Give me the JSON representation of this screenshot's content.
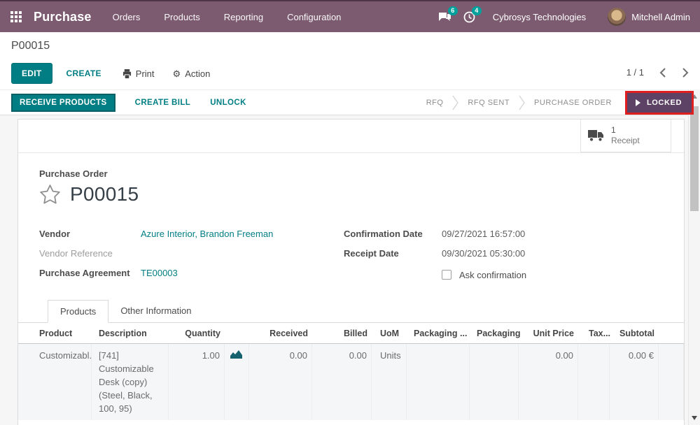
{
  "nav": {
    "app_name": "Purchase",
    "menus": [
      "Orders",
      "Products",
      "Reporting",
      "Configuration"
    ],
    "messages_badge": "6",
    "activities_badge": "4",
    "company": "Cybrosys Technologies",
    "user": "Mitchell Admin"
  },
  "control_panel": {
    "breadcrumb": "P00015",
    "edit_label": "EDIT",
    "create_label": "CREATE",
    "print_label": "Print",
    "action_label": "Action",
    "pager": "1 / 1"
  },
  "status_bar": {
    "receive_products_label": "RECEIVE PRODUCTS",
    "create_bill_label": "CREATE BILL",
    "unlock_label": "UNLOCK",
    "stages": [
      "RFQ",
      "RFQ SENT",
      "PURCHASE ORDER",
      "LOCKED"
    ],
    "active_stage": "LOCKED"
  },
  "form": {
    "smart_button": {
      "count": "1",
      "label": "Receipt"
    },
    "title_label": "Purchase Order",
    "title": "P00015",
    "fields_left": [
      {
        "label": "Vendor",
        "value": "Azure Interior, Brandon Freeman"
      },
      {
        "label": "Vendor Reference",
        "value": ""
      },
      {
        "label": "Purchase Agreement",
        "value": "TE00003"
      }
    ],
    "fields_right": [
      {
        "label": "Confirmation Date",
        "value": "09/27/2021 16:57:00"
      },
      {
        "label": "Receipt Date",
        "value": "09/30/2021 05:30:00"
      }
    ],
    "checkbox_label": "Ask confirmation",
    "tabs": [
      "Products",
      "Other Information"
    ],
    "table": {
      "headers": [
        "Product",
        "Description",
        "Quantity",
        "Received",
        "Billed",
        "UoM",
        "Packaging ...",
        "Packaging",
        "Unit Price",
        "Tax...",
        "Subtotal"
      ],
      "rows": [
        {
          "product": "Customizabl...",
          "description": "[741] Customizable Desk (copy) (Steel, Black, 100, 95)",
          "quantity": "1.00",
          "received": "0.00",
          "billed": "0.00",
          "uom": "Units",
          "packaging_qty": "",
          "packaging": "",
          "unit_price": "0.00",
          "taxes": "",
          "subtotal": "0.00 €"
        }
      ]
    }
  },
  "colors": {
    "navbar_purple": "#7c5a70",
    "accent_teal": "#017e84",
    "badge_teal": "#00a09d",
    "stage_active_purple": "#5d4265",
    "annotation_red": "#df1f1f"
  }
}
